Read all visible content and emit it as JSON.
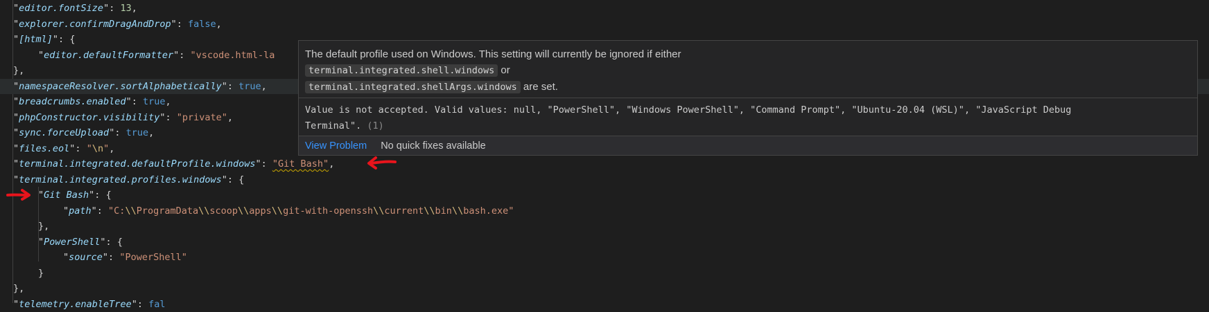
{
  "editor": {
    "lines": [
      {
        "key": "editor.fontSize",
        "value": "13",
        "vtype": "n",
        "indent": 0,
        "trail": ","
      },
      {
        "key": "explorer.confirmDragAndDrop",
        "value": "false",
        "vtype": "b",
        "indent": 0,
        "trail": ","
      },
      {
        "key": "[html]",
        "value": "{",
        "vtype": "p",
        "indent": 0,
        "trail": ""
      },
      {
        "key": "editor.defaultFormatter",
        "value": "\"vscode.html-la",
        "vtype": "s",
        "indent": 1,
        "trail": ""
      },
      {
        "raw": "},",
        "indent": 0
      },
      {
        "key": "namespaceResolver.sortAlphabetically",
        "value": "true",
        "vtype": "b",
        "indent": 0,
        "trail": ",",
        "highlight": true
      },
      {
        "key": "breadcrumbs.enabled",
        "value": "true",
        "vtype": "b",
        "indent": 0,
        "trail": ","
      },
      {
        "key": "phpConstructor.visibility",
        "value": "\"private\"",
        "vtype": "s",
        "indent": 0,
        "trail": ","
      },
      {
        "key": "sync.forceUpload",
        "value": "true",
        "vtype": "b",
        "indent": 0,
        "trail": ","
      },
      {
        "key": "files.eol",
        "value": "\"\\n\"",
        "vtype": "esc",
        "indent": 0,
        "trail": ","
      },
      {
        "key": "terminal.integrated.defaultProfile.windows",
        "value": "\"Git Bash\"",
        "vtype": "s",
        "indent": 0,
        "trail": ",",
        "squiggle": true
      },
      {
        "key": "terminal.integrated.profiles.windows",
        "value": "{",
        "vtype": "p",
        "indent": 0,
        "trail": ""
      },
      {
        "key": "Git Bash",
        "value": "{",
        "vtype": "p",
        "indent": 1,
        "trail": ""
      },
      {
        "key": "path",
        "value": "\"C:\\\\ProgramData\\\\scoop\\\\apps\\\\git-with-openssh\\\\current\\\\bin\\\\bash.exe\"",
        "vtype": "path",
        "indent": 2,
        "trail": ""
      },
      {
        "raw": "},",
        "indent": 1
      },
      {
        "key": "PowerShell",
        "value": "{",
        "vtype": "p",
        "indent": 1,
        "trail": ""
      },
      {
        "key": "source",
        "value": "\"PowerShell\"",
        "vtype": "s",
        "indent": 2,
        "trail": ""
      },
      {
        "raw": "}",
        "indent": 1
      },
      {
        "raw": "},",
        "indent": 0
      },
      {
        "key": "telemetry.enableTree",
        "value": "fal",
        "vtype": "b",
        "indent": 0,
        "trail": "",
        "partial": true
      }
    ]
  },
  "hover": {
    "doc_line1": "The default profile used on Windows. This setting will currently be ignored if either",
    "chip1": "terminal.integrated.shell.windows",
    "or": "or",
    "chip2": "terminal.integrated.shellArgs.windows",
    "are_set": "are set.",
    "problem_text": "Value is not accepted. Valid values: null, \"PowerShell\", \"Windows PowerShell\", \"Command Prompt\", \"Ubuntu-20.04 (WSL)\", \"JavaScript Debug",
    "problem_text2": "Terminal\".",
    "problem_code": "(1)",
    "view_problem": "View Problem",
    "no_fixes": "No quick fixes available"
  },
  "colors": {
    "arrow": "#e8141c",
    "link": "#3794ff",
    "squiggle": "#cca700"
  }
}
